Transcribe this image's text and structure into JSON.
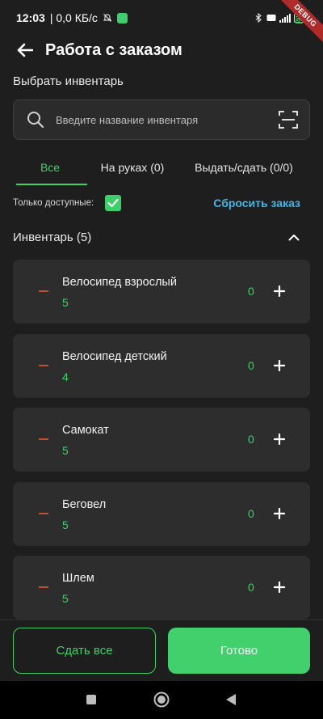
{
  "status_bar": {
    "time": "12:03",
    "network_speed": "| 0,0 КБ/с",
    "battery_level": "52"
  },
  "debug_badge": "DEBUG",
  "app_bar": {
    "title": "Работа с заказом",
    "back_icon": "arrow-left-icon"
  },
  "select_label": "Выбрать инвентарь",
  "search": {
    "placeholder": "Введите название инвентаря",
    "value": "",
    "scan_icon": "barcode-scan-icon"
  },
  "tabs": [
    {
      "label": "Все",
      "active": true
    },
    {
      "label": "На руках (0)",
      "active": false
    },
    {
      "label": "Выдать/сдать (0/0)",
      "active": false
    }
  ],
  "filter": {
    "label": "Только доступные:",
    "checked": true,
    "reset_label": "Сбросить заказ"
  },
  "inventory": {
    "title": "Инвентарь (5)",
    "collapse_icon": "chevron-up-icon",
    "items": [
      {
        "name": "Велосипед взрослый",
        "available": "5",
        "count": "0"
      },
      {
        "name": "Велосипед детский",
        "available": "4",
        "count": "0"
      },
      {
        "name": "Самокат",
        "available": "5",
        "count": "0"
      },
      {
        "name": "Беговел",
        "available": "5",
        "count": "0"
      },
      {
        "name": "Шлем",
        "available": "5",
        "count": "0"
      }
    ]
  },
  "actions": {
    "return_all": "Сдать все",
    "done": "Готово"
  },
  "colors": {
    "accent": "#3fcf6a",
    "link": "#41b5e6",
    "minus": "#c0502e",
    "card": "#2d2d2d",
    "background": "#1e1e1e"
  }
}
